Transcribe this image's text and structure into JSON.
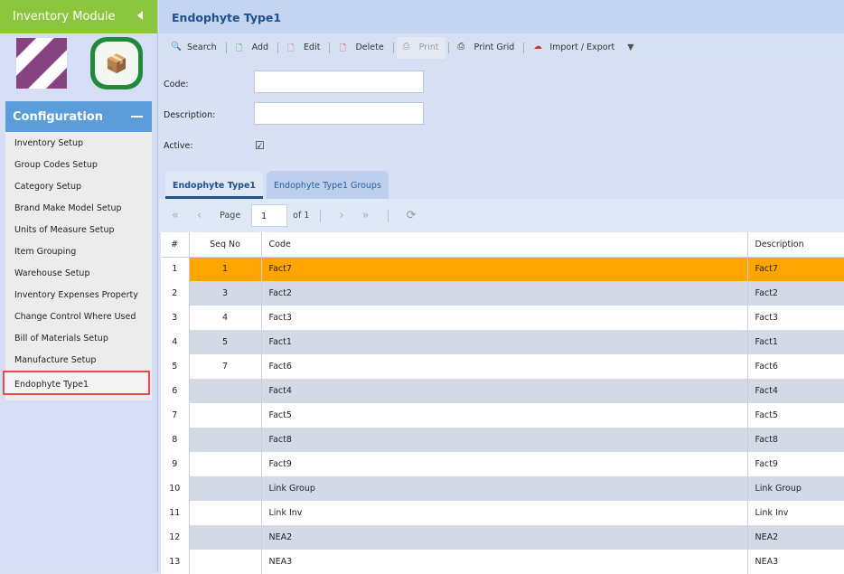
{
  "sidebar": {
    "module_title": "Inventory Module",
    "section": "Configuration",
    "items": [
      "Inventory Setup",
      "Group Codes Setup",
      "Category Setup",
      "Brand Make Model Setup",
      "Units of Measure Setup",
      "Item Grouping",
      "Warehouse Setup",
      "Inventory Expenses Property",
      "Change Control Where Used",
      "Bill of Materials Setup",
      "Manufacture Setup",
      "Endophyte Type1"
    ],
    "selected_index": 11
  },
  "page_title": "Endophyte Type1",
  "toolbar": {
    "search": "Search",
    "add": "Add",
    "edit": "Edit",
    "delete": "Delete",
    "print": "Print",
    "print_grid": "Print Grid",
    "import_export": "Import / Export"
  },
  "form": {
    "code_label": "Code:",
    "code_value": "",
    "description_label": "Description:",
    "description_value": "",
    "active_label": "Active:",
    "active": true
  },
  "tabs": [
    "Endophyte Type1",
    "Endophyte Type1 Groups"
  ],
  "pager": {
    "page_label": "Page",
    "page": "1",
    "of": "of 1"
  },
  "grid": {
    "headers": [
      "#",
      "Seq No",
      "Code",
      "Description"
    ],
    "rows": [
      [
        "1",
        "1",
        "Fact7",
        "Fact7"
      ],
      [
        "2",
        "3",
        "Fact2",
        "Fact2"
      ],
      [
        "3",
        "4",
        "Fact3",
        "Fact3"
      ],
      [
        "4",
        "5",
        "Fact1",
        "Fact1"
      ],
      [
        "5",
        "7",
        "Fact6",
        "Fact6"
      ],
      [
        "6",
        "",
        "Fact4",
        "Fact4"
      ],
      [
        "7",
        "",
        "Fact5",
        "Fact5"
      ],
      [
        "8",
        "",
        "Fact8",
        "Fact8"
      ],
      [
        "9",
        "",
        "Fact9",
        "Fact9"
      ],
      [
        "10",
        "",
        "Link Group",
        "Link Group"
      ],
      [
        "11",
        "",
        "Link Inv",
        "Link Inv"
      ],
      [
        "12",
        "",
        "NEA2",
        "NEA2"
      ],
      [
        "13",
        "",
        "NEA3",
        "NEA3"
      ]
    ],
    "selected_row": 0
  }
}
